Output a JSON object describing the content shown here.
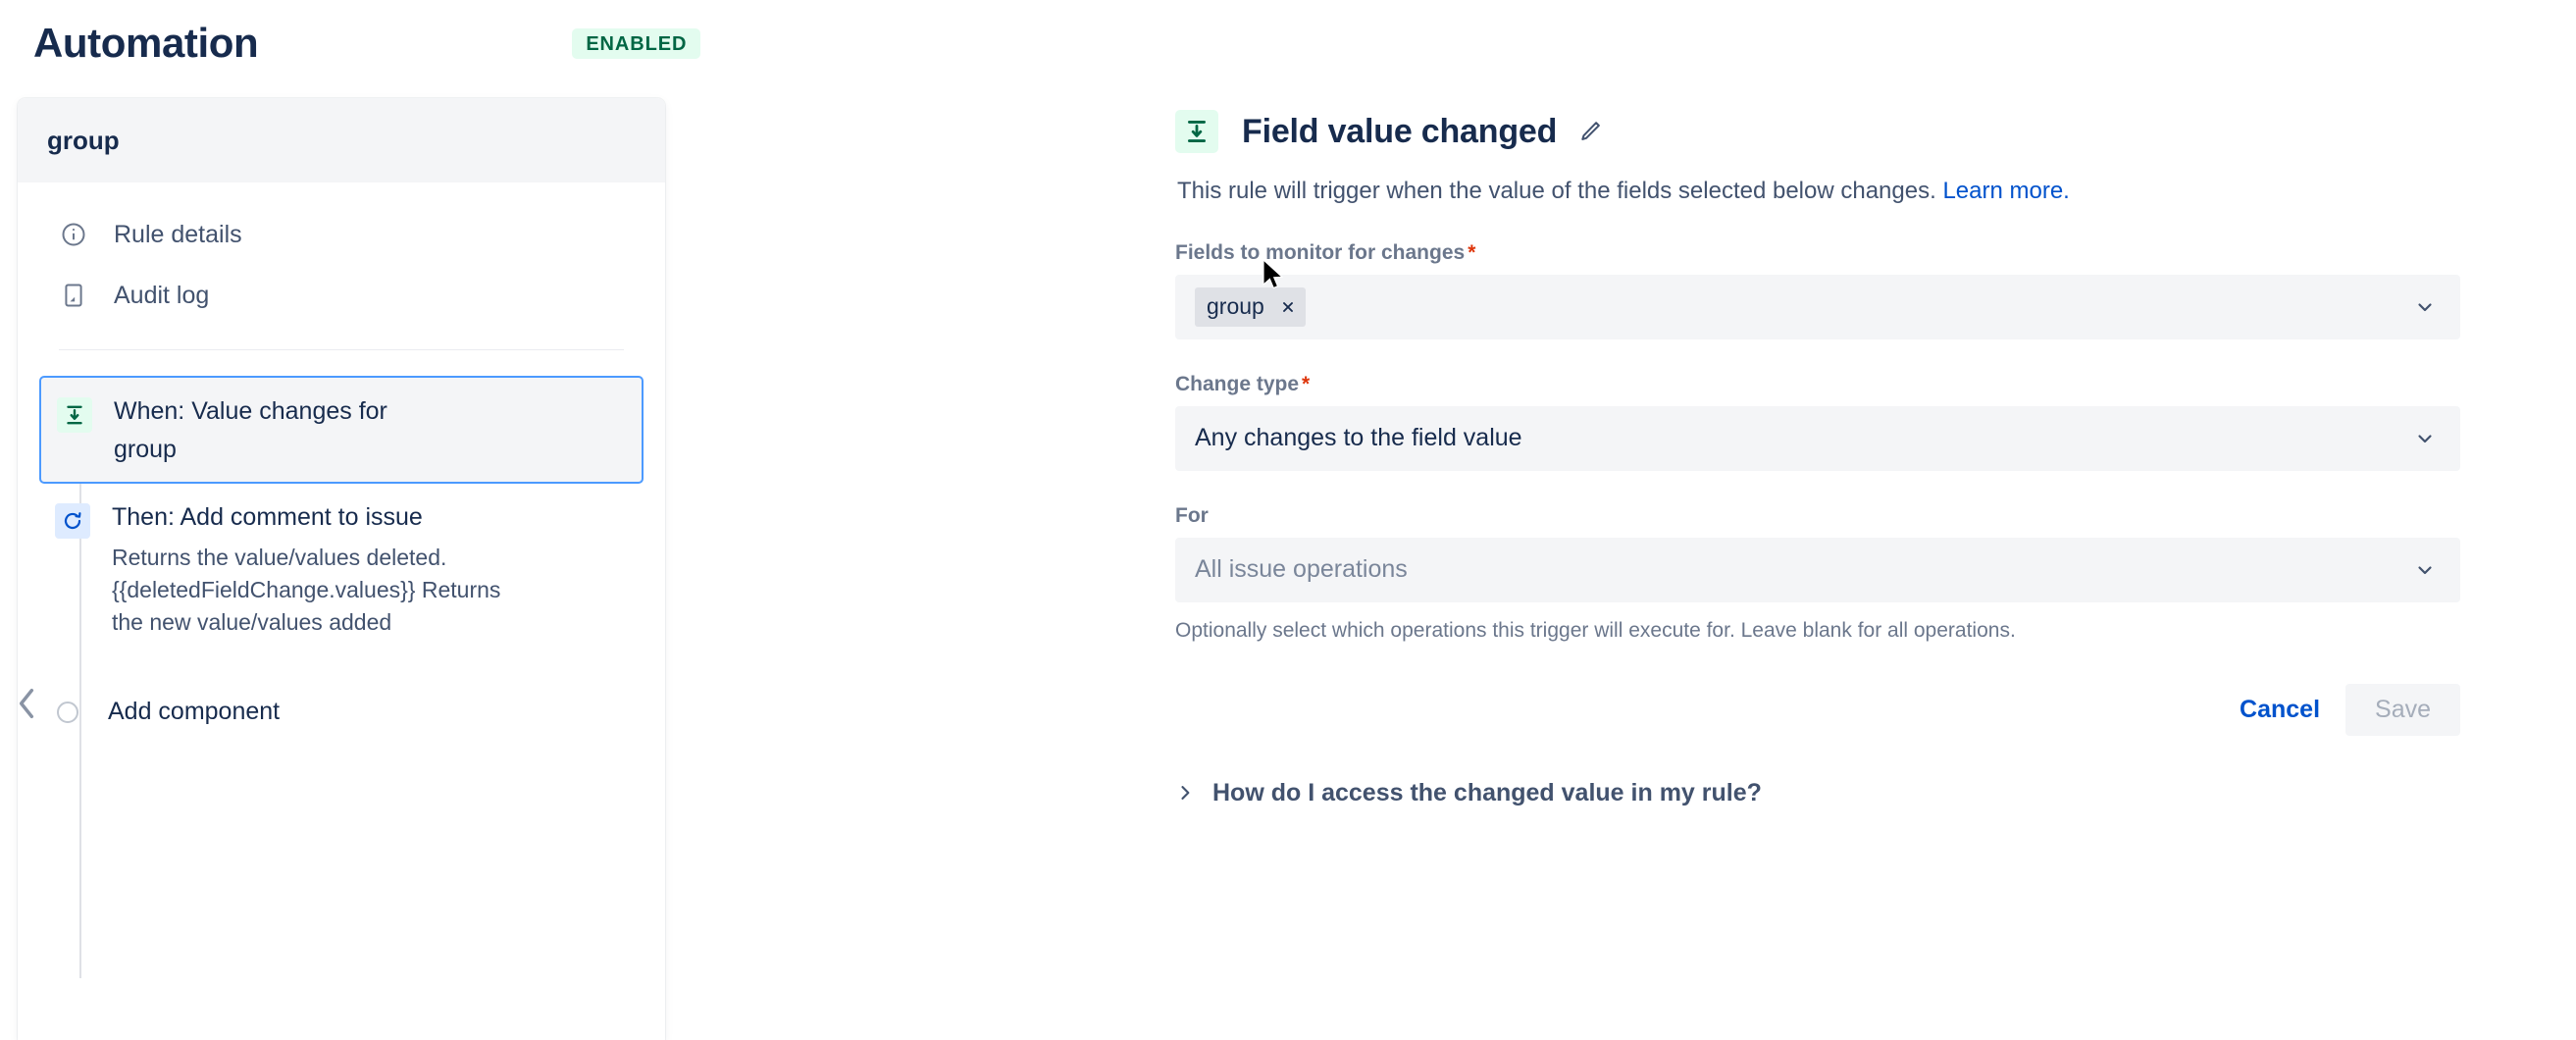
{
  "header": {
    "title": "Automation",
    "status_badge": "ENABLED"
  },
  "sidebar": {
    "panel_title": "group",
    "nav_items": [
      {
        "label": "Rule details",
        "icon": "info-circle-icon"
      },
      {
        "label": "Audit log",
        "icon": "document-icon"
      }
    ],
    "flow": {
      "trigger": {
        "title": "When: Value changes for",
        "subtitle": "group",
        "icon": "field-value-changed-icon",
        "selected": true
      },
      "action": {
        "title": "Then: Add comment to issue",
        "description": "Returns the value/values deleted. {{deletedFieldChange.values}} Returns the new value/values added",
        "icon": "refresh-icon"
      },
      "add_component_label": "Add component"
    },
    "collapse_icon": "chevron-left-icon"
  },
  "detail": {
    "icon": "field-value-changed-icon",
    "title": "Field value changed",
    "edit_icon": "pencil-icon",
    "description": "This rule will trigger when the value of the fields selected below changes.",
    "learn_more": "Learn more.",
    "fields": {
      "monitor": {
        "label": "Fields to monitor for changes",
        "required": "*",
        "chips": [
          {
            "label": "group",
            "remove_icon": "close-icon"
          }
        ],
        "chevron_icon": "chevron-down-icon"
      },
      "change_type": {
        "label": "Change type",
        "required": "*",
        "value": "Any changes to the field value",
        "chevron_icon": "chevron-down-icon"
      },
      "for": {
        "label": "For",
        "placeholder": "All issue operations",
        "helper": "Optionally select which operations this trigger will execute for. Leave blank for all operations.",
        "chevron_icon": "chevron-down-icon"
      }
    },
    "buttons": {
      "cancel": "Cancel",
      "save": "Save"
    },
    "expander": {
      "label": "How do I access the changed value in my rule?",
      "icon": "chevron-right-icon"
    }
  },
  "colors": {
    "accent_blue": "#0052cc",
    "selected_border": "#4c9aff",
    "success_green": "#006644",
    "success_bg": "#e3fcef",
    "required_red": "#de350b",
    "text_primary": "#172b4d",
    "text_subtle": "#6b778c",
    "field_bg": "#f4f5f7"
  }
}
